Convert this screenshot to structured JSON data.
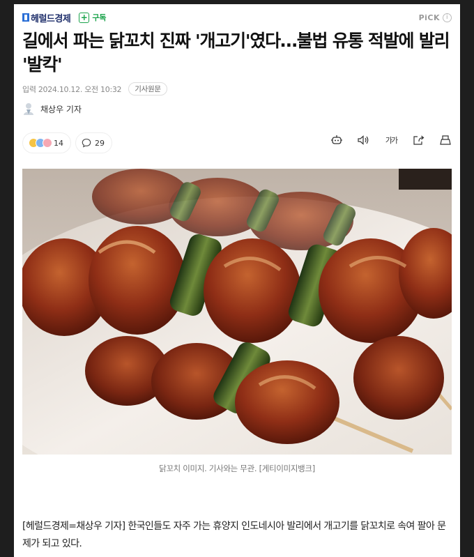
{
  "header": {
    "logo": "헤럴드경제",
    "subscribe_label": "구독",
    "pick_label": "PiCK",
    "pick_info": "i"
  },
  "article": {
    "headline": "길에서 파는 닭꼬치 진짜 '개고기'였다…불법 유통 적발에 발리 '발칵'",
    "published": "입력 2024.10.12. 오전 10:32",
    "original_link_label": "기사원문",
    "reporter": "채상우 기자",
    "reactions_count": "14",
    "comments_count": "29",
    "font_size_label": "가가",
    "image_caption": "닭꼬치 이미지. 기사와는 무관. [게티이미지뱅크]",
    "lead": "[헤럴드경제=채상우 기자] 한국인들도 자주 가는 휴양지 인도네시아 발리에서 개고기를 닭꼬치로 속여 팔아 문제가 되고 있다."
  },
  "colors": {
    "brand": "#1f2f6b",
    "subscribe": "#1aa34a",
    "frame_bg": "#1e1e1e"
  },
  "icons": [
    "subscribe-plus-icon",
    "info-icon",
    "reporter-avatar-icon",
    "reaction-emoji-icon",
    "comment-icon",
    "audio-robot-icon",
    "speaker-icon",
    "share-icon",
    "print-icon"
  ]
}
